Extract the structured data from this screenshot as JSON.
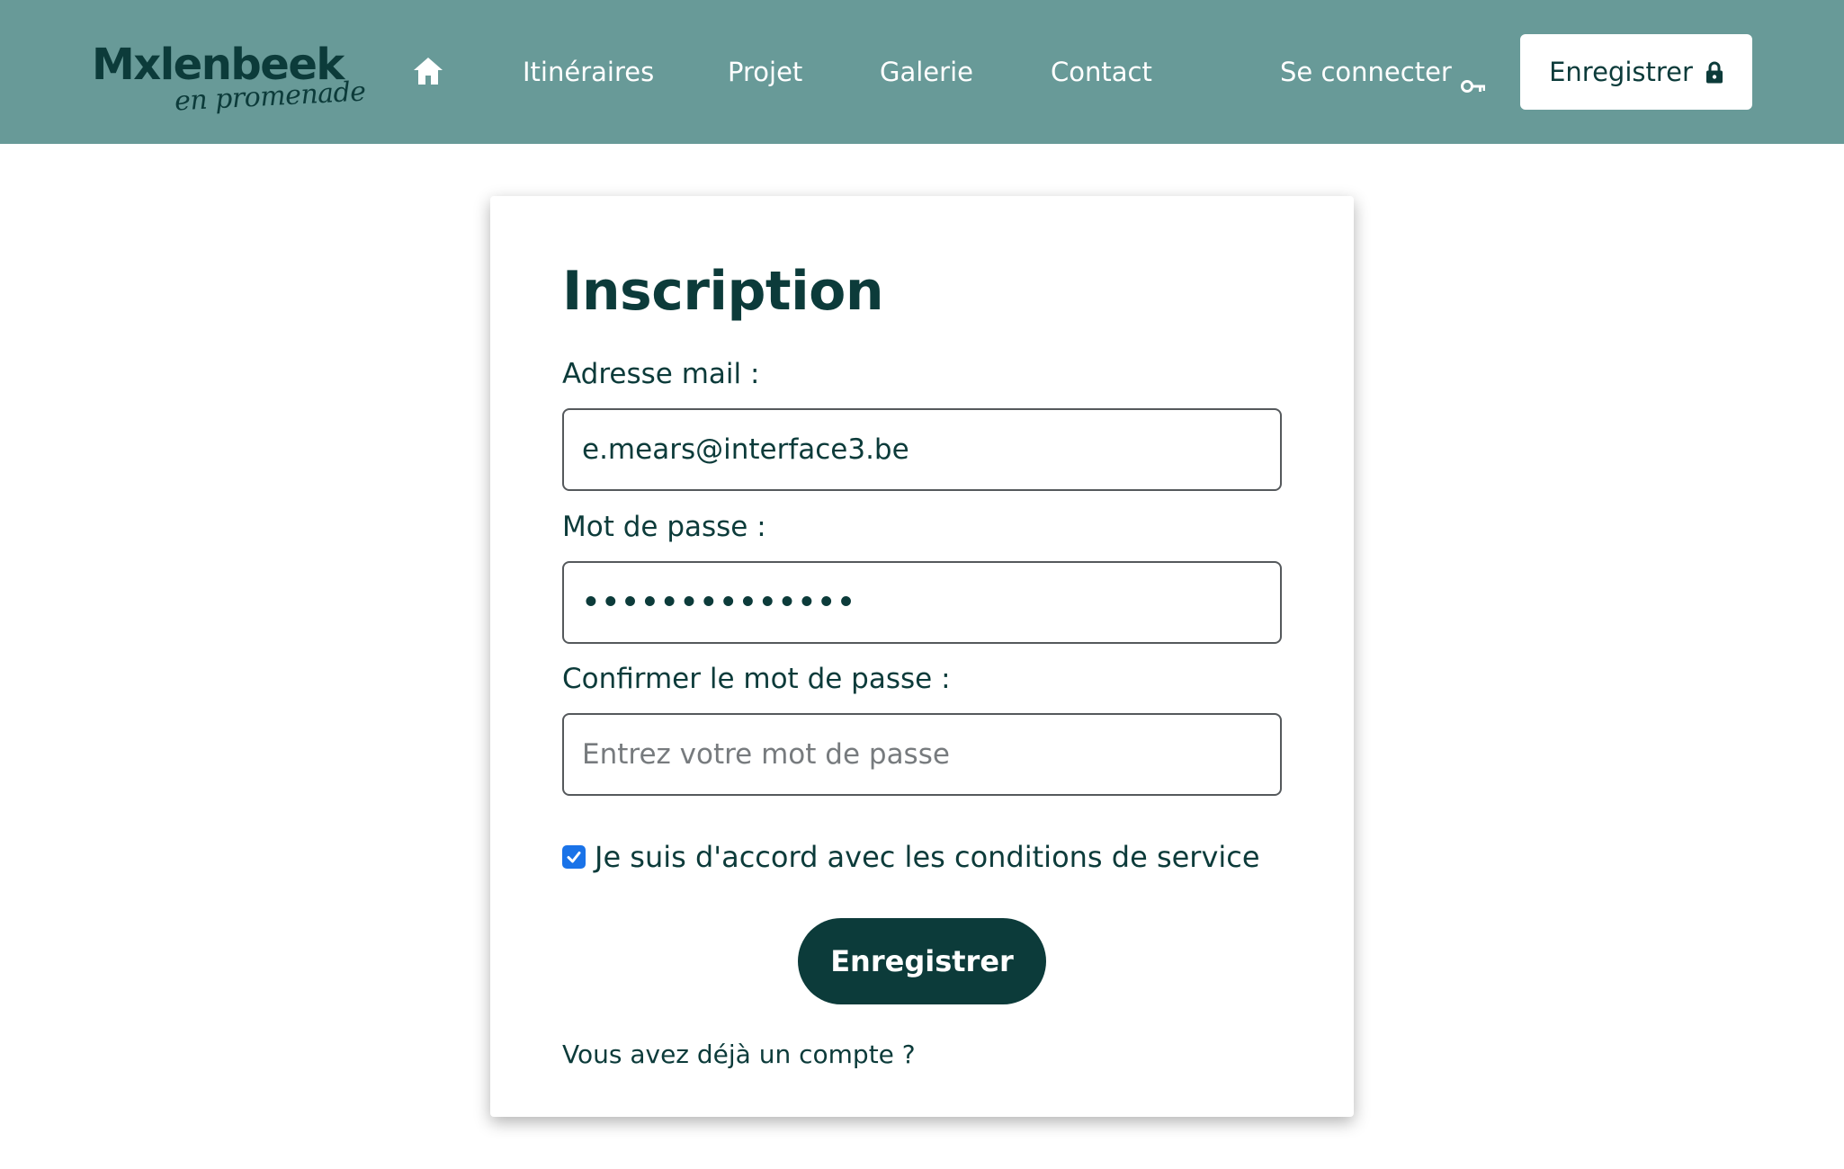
{
  "header": {
    "logo": {
      "main": "Mxlenbeek",
      "sub": "en promenade"
    },
    "nav": {
      "home_icon": "home-icon",
      "itineraires": "Itinéraires",
      "projet": "Projet",
      "galerie": "Galerie",
      "contact": "Contact"
    },
    "login": {
      "label": "Se connecter",
      "icon": "key-icon"
    },
    "register": {
      "label": "Enregistrer",
      "icon": "lock-icon"
    }
  },
  "form": {
    "title": "Inscription",
    "email": {
      "label": "Adresse mail :",
      "value": "e.mears@interface3.be"
    },
    "password": {
      "label": "Mot de passe :",
      "value": "••••••••••••••"
    },
    "confirm": {
      "label": "Confirmer le mot de passe :",
      "value": "",
      "placeholder": "Entrez votre mot de passe"
    },
    "terms": {
      "label": "Je suis d'accord avec les conditions de service",
      "checked": true
    },
    "submit_label": "Enregistrer",
    "have_account": "Vous avez déjà un compte ?"
  },
  "colors": {
    "header_bg": "#689a98",
    "brand_dark": "#0c3b3a",
    "checkbox": "#1a73e8"
  }
}
